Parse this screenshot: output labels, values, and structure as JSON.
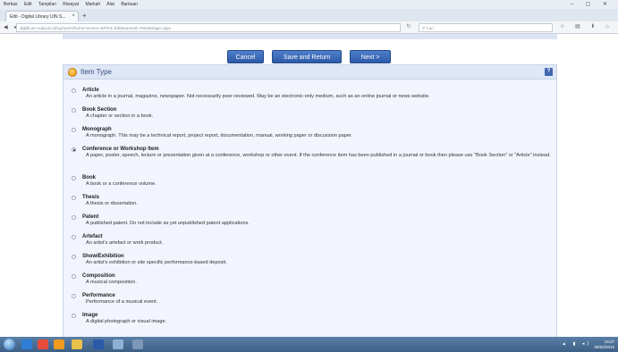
{
  "browser": {
    "menu": [
      "Berkas",
      "Edit",
      "Tampilan",
      "Riwayat",
      "Markah",
      "Alat",
      "Bantuan"
    ],
    "tab_title": "Edit - Digital Library UIN S...",
    "url": "digilib.uin-suka.ac.id/cgi/users/home?screen=EPrint::Edit&eprintid=7652&stage=type",
    "search_placeholder": "Cari"
  },
  "actions": {
    "cancel": "Cancel",
    "save_return": "Save and Return",
    "next": "Next >"
  },
  "panel": {
    "title": "Item Type",
    "help": "?"
  },
  "item_types": [
    {
      "title": "Article",
      "desc": "An article in a journal, magazine, newspaper. Not necessarily peer-reviewed. May be an electronic-only medium, such as an online journal or news website.",
      "selected": false
    },
    {
      "title": "Book Section",
      "desc": "A chapter or section in a book.",
      "selected": false
    },
    {
      "title": "Monograph",
      "desc": "A monograph. This may be a technical report, project report, documentation, manual, working paper or discussion paper.",
      "selected": false
    },
    {
      "title": "Conference or Workshop Item",
      "desc": "A paper, poster, speech, lecture or presentation given at a conference, workshop or other event. If the conference item has been published in a journal or book then please use \"Book Section\" or \"Article\" instead.",
      "selected": true
    },
    {
      "title": "Book",
      "desc": "A book or a conference volume.",
      "selected": false
    },
    {
      "title": "Thesis",
      "desc": "A thesis or dissertation.",
      "selected": false
    },
    {
      "title": "Patent",
      "desc": "A published patent. Do not include as yet unpublished patent applications.",
      "selected": false
    },
    {
      "title": "Artefact",
      "desc": "An artist's artefact or work product.",
      "selected": false
    },
    {
      "title": "Show/Exhibition",
      "desc": "An artist's exhibition or site specific performance-based deposit.",
      "selected": false
    },
    {
      "title": "Composition",
      "desc": "A musical composition.",
      "selected": false
    },
    {
      "title": "Performance",
      "desc": "Performance of a musical event.",
      "selected": false
    },
    {
      "title": "Image",
      "desc": "A digital photograph or visual image.",
      "selected": false
    }
  ],
  "taskbar": {
    "time": "14:27",
    "date": "08/02/2016"
  },
  "colors": {
    "button": "#3566b6",
    "panel_bg": "#f2f5fd",
    "panel_head": "#dfe7f6",
    "taskbar": "#4a6f97"
  }
}
